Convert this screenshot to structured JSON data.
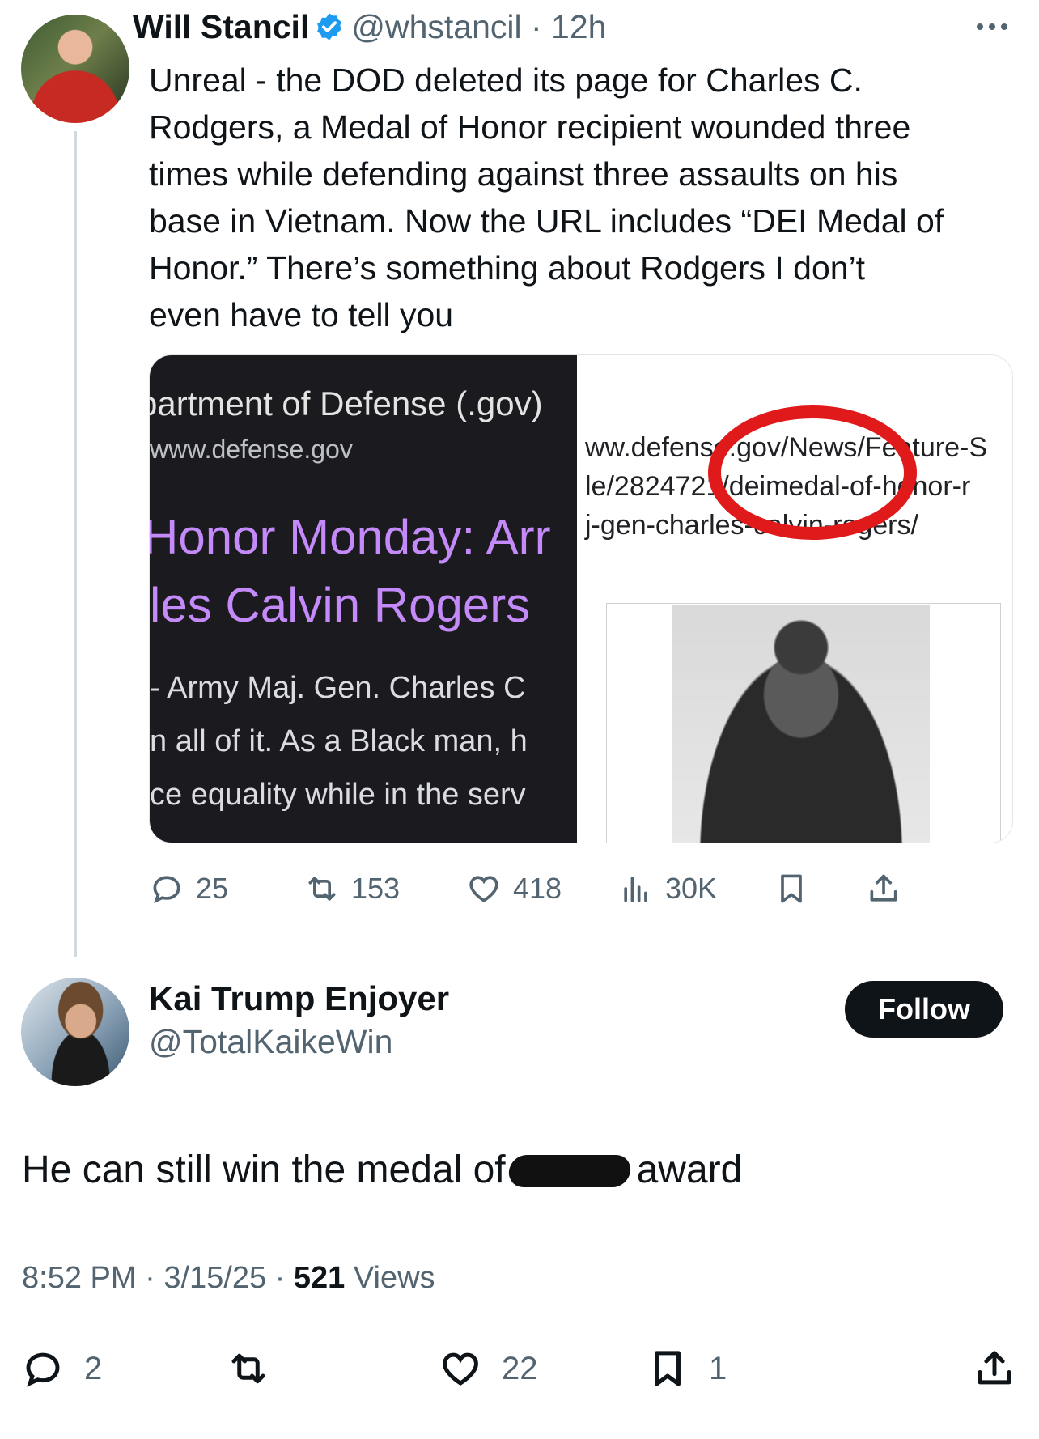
{
  "parent_tweet": {
    "author_name": "Will Stancil",
    "handle": "@whstancil",
    "time": "12h",
    "text": "Unreal - the DOD deleted its page for Charles C.\nRodgers, a Medal of Honor recipient wounded three\ntimes while defending against three assaults on his\nbase in Vietnam. Now the URL includes “DEI Medal of\nHonor.” There’s something about Rodgers I don’t\neven have to tell you",
    "media": {
      "left": {
        "site": "partment of Defense (.gov)",
        "url": "www.defense.gov",
        "headline_1": "Honor Monday: Arr",
        "headline_2": "les Calvin Rogers",
        "snippet_1": "- Army Maj. Gen. Charles C",
        "snippet_2": "n all of it. As a Black man, h",
        "snippet_3": "ce equality while in the serv"
      },
      "right": {
        "url_text": "ww.defense.gov/News/Feature-S\nle/2824721/deimedal-of-honor-r\nj-gen-charles-calvin-rogers/"
      }
    },
    "stats": {
      "replies": "25",
      "reposts": "153",
      "likes": "418",
      "views": "30K"
    }
  },
  "reply": {
    "author_name": "Kai Trump Enjoyer",
    "handle": "@TotalKaikeWin",
    "follow_label": "Follow",
    "text_before": "He can still win the medal of",
    "text_after": "award",
    "time": "8:52 PM",
    "date": "3/15/25",
    "views_count": "521",
    "views_label": "Views",
    "stats": {
      "replies": "2",
      "likes": "22",
      "bookmarks": "1"
    }
  },
  "colors": {
    "accent_verified": "#1d9bf0",
    "secondary_text": "#536471",
    "link_purple": "#c58af9",
    "circle_red": "#e0191a"
  },
  "icons": [
    "verified-badge-icon",
    "more-icon",
    "reply-icon",
    "repost-icon",
    "like-icon",
    "views-icon",
    "bookmark-icon",
    "share-icon"
  ]
}
